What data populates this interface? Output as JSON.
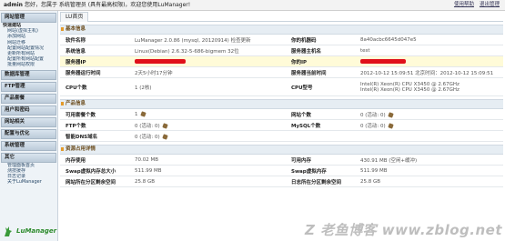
{
  "topbar": {
    "user": "admin",
    "greeting": "您好，您属于 系统管理员 (具有最高权限)，欢迎您使用LuManager!",
    "links": [
      "使用帮助",
      "退出管理"
    ]
  },
  "sidebar": [
    {
      "title": "网站管理",
      "items": [
        "快速建站",
        "网站(虚拟主机)",
        "添加网站",
        "网站迁移",
        "配置网站配置情况",
        "更新所有网站",
        "配置所有网站配置",
        "批量网站权限"
      ]
    },
    {
      "title": "数据库管理",
      "items": []
    },
    {
      "title": "FTP管理",
      "items": []
    },
    {
      "title": "产品套餐",
      "items": []
    },
    {
      "title": "用户和密码",
      "items": []
    },
    {
      "title": "网站相关",
      "items": []
    },
    {
      "title": "配置与优化",
      "items": []
    },
    {
      "title": "系统管理",
      "items": []
    },
    {
      "title": "其它",
      "items": [
        "管理面板首页",
        "测技援存",
        "日志记录",
        "关于LuManager"
      ]
    }
  ],
  "logo": {
    "text": "LuManager"
  },
  "main": {
    "tab": "LU首页",
    "basic_title": "基本信息",
    "basic_rows": [
      {
        "k1": "软件名称",
        "v1": "LuManager 2.0.86 (mysql, 20120914) 检查更新",
        "k2": "你的机器码",
        "v2": "8a40acbc6645d047e5"
      },
      {
        "k1": "系统信息",
        "v1": "Linux(Debian)   2.6.32-5-686-bigmem   32位",
        "k2": "服务器主机名",
        "v2": "test"
      },
      {
        "k1": "服务器IP",
        "v1": "",
        "k2": "你的IP",
        "v2": ""
      },
      {
        "k1": "服务器运行时间",
        "v1": "2天5小时17分钟",
        "k2": "服务器当前时间",
        "v2": "2012-10-12 15:09:51  北京时间：2012-10-12 15:09:51"
      },
      {
        "k1": "CPU个数",
        "v1": "1 (2核)",
        "k2": "CPU型号",
        "v2": "Intel(R) Xeon(R) CPU X3450 @ 2.67GHz",
        "v2b": "Intel(R) Xeon(R) CPU X3450 @ 2.67GHz"
      }
    ],
    "product_title": "产品信息",
    "product_rows": [
      {
        "k1": "可用套餐个数",
        "v1": "1",
        "k2": "网站个数",
        "v2": "0 (活动: 0)"
      },
      {
        "k1": "FTP个数",
        "v1": "0 (活动: 0)",
        "k2": "MySQL个数",
        "v2": "0 (活动: 0)"
      },
      {
        "k1": "智能DNS域名",
        "v1": "0 (活动: 0)",
        "k2": "",
        "v2": ""
      }
    ],
    "resource_title": "资源占用详情",
    "resource_rows": [
      {
        "k1": "内存使用",
        "v1": "70.02 MB",
        "k2": "可用内存",
        "v2": "430.91 MB (空闲+缓冲)"
      },
      {
        "k1": "Swap虚拟内存总大小",
        "v1": "511.99 MB",
        "k2": "Swap虚拟内存",
        "v2": "511.99 MB"
      },
      {
        "k1": "网站所在分区剩余空间",
        "v1": "25.8 GB",
        "k2": "日志所在分区剩余空间",
        "v2": "25.8 GB"
      }
    ]
  },
  "watermark": "Z 老鱼博客 www.zblog.net",
  "colors": {
    "accent": "#e39a2b",
    "redaction": "#e0101a",
    "highlight_row": "#fffbd8",
    "section_bar": "#bccbd9"
  }
}
